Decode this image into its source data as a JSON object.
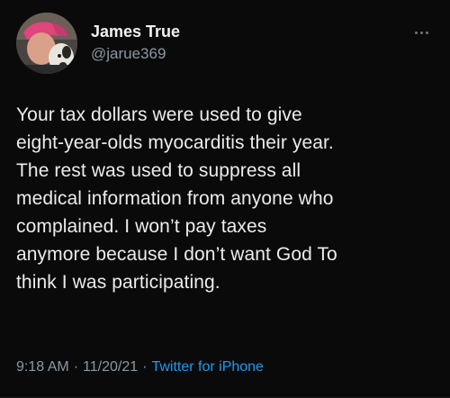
{
  "tweet": {
    "author": {
      "display_name": "James True",
      "handle": "@jarue369"
    },
    "text": "Your tax dollars were used to give\neight-year-olds myocarditis their year.\nThe rest was used to suppress all\nmedical information from anyone who\ncomplained. I won’t pay taxes\nanymore because I don’t want God To\nthink I was participating.",
    "time": "9:18 AM",
    "date": "11/20/21",
    "separator": "·",
    "source": "Twitter for iPhone"
  },
  "colors": {
    "background": "#000000",
    "text": "#e7e9ea",
    "secondary": "#8b98a5",
    "link": "#1d9bf0"
  },
  "icons": {
    "more": "more-dots-icon"
  }
}
